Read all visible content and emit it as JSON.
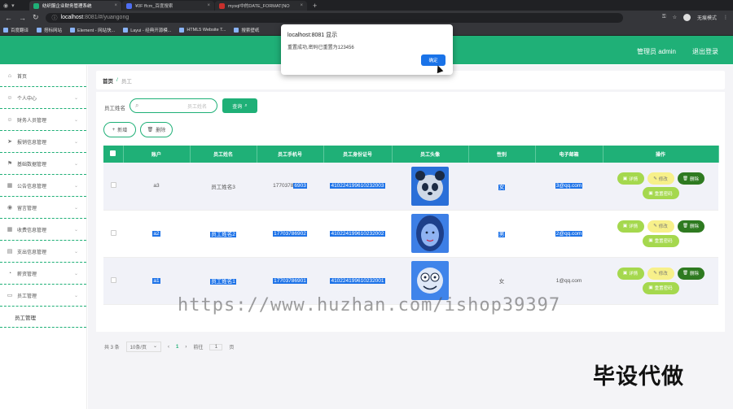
{
  "browser": {
    "tabs": [
      {
        "title": "纺织服企业财务管理系统",
        "active": true,
        "color": "#1fb077"
      },
      {
        "title": "¥0F ffcm_百度搜索",
        "active": false,
        "color": "#4e6ef2"
      },
      {
        "title": "mysql中的DATE_FORMAT(NO",
        "active": false,
        "color": "#c9302c"
      }
    ],
    "url_host": "localhost",
    "url_path": ":8081/#/yuangong",
    "incognito_label": "无痕模式",
    "bookmarks": [
      "百度翻译",
      "搭标网站",
      "Element - 网站快...",
      "Layui - 经典开源模...",
      "HTML5 Website T...",
      "搜索壁纸"
    ]
  },
  "header": {
    "user_label": "管理员 admin",
    "logout_label": "退出登录"
  },
  "sidebar": {
    "items": [
      {
        "label": "首页",
        "icon": "home-icon",
        "glyph": "⌂",
        "chevron": false
      },
      {
        "label": "个人中心",
        "icon": "person-icon",
        "glyph": "☺",
        "chevron": true
      },
      {
        "label": "财务人员管理",
        "icon": "people-icon",
        "glyph": "☺",
        "chevron": true
      },
      {
        "label": "报销信息管理",
        "icon": "send-icon",
        "glyph": "➤",
        "chevron": true
      },
      {
        "label": "基础数据管理",
        "icon": "flag-icon",
        "glyph": "⚑",
        "chevron": true
      },
      {
        "label": "公告信息管理",
        "icon": "calendar-icon",
        "glyph": "▦",
        "chevron": true
      },
      {
        "label": "留言管理",
        "icon": "location-icon",
        "glyph": "◉",
        "chevron": true
      },
      {
        "label": "收费信息管理",
        "icon": "grid-icon",
        "glyph": "▦",
        "chevron": true
      },
      {
        "label": "支出信息管理",
        "icon": "table-icon",
        "glyph": "▤",
        "chevron": true
      },
      {
        "label": "薪资管理",
        "icon": "clock-icon",
        "glyph": "◔",
        "chevron": true
      },
      {
        "label": "员工管理",
        "icon": "monitor-icon",
        "glyph": "▭",
        "chevron": true
      }
    ],
    "sub_item": "员工管理"
  },
  "breadcrumb": {
    "home": "首页",
    "sep": "/",
    "current": "员工"
  },
  "search": {
    "label": "员工姓名",
    "placeholder": "员工姓名",
    "button": "查询"
  },
  "toolbar": {
    "add": "新增",
    "delete": "删除"
  },
  "table": {
    "headers": [
      "账户",
      "员工姓名",
      "员工手机号",
      "员工身份证号",
      "员工头像",
      "性别",
      "电子邮箱",
      "操作"
    ],
    "rows": [
      {
        "account": "a3",
        "name": "员工姓名3",
        "phone_plain": "1770378",
        "phone_hl": "6903",
        "idcard": "410224199610232003",
        "gender": "女",
        "email_hl": "3@qq.com",
        "avatar": "panda"
      },
      {
        "account": "a2",
        "name": "员工姓名2",
        "phone_plain": "",
        "phone_hl": "17703786902",
        "idcard": "410224199610232002",
        "gender": "男",
        "email_hl": "2@qq.com",
        "avatar": "portrait"
      },
      {
        "account": "a1",
        "name": "员工姓名1",
        "phone_plain": "",
        "phone_hl": "17703786901",
        "idcard": "410224199610232001",
        "gender": "女",
        "email_plain": "1@qq.com",
        "avatar": "cartoon"
      }
    ],
    "actions": {
      "detail": "详情",
      "edit": "修改",
      "delete": "删除",
      "reset": "重置密码"
    }
  },
  "pager": {
    "total": "共 3 条",
    "size": "10条/页",
    "page": "1",
    "goto": "前往",
    "goto_val": "1",
    "page_unit": "页"
  },
  "dialog": {
    "title": "localhost:8081 显示",
    "message": "重置成功,密码已重置为123456",
    "ok": "确定"
  },
  "watermark": "https://www.huzhan.com/ishop39397",
  "stamp": "毕设代做"
}
